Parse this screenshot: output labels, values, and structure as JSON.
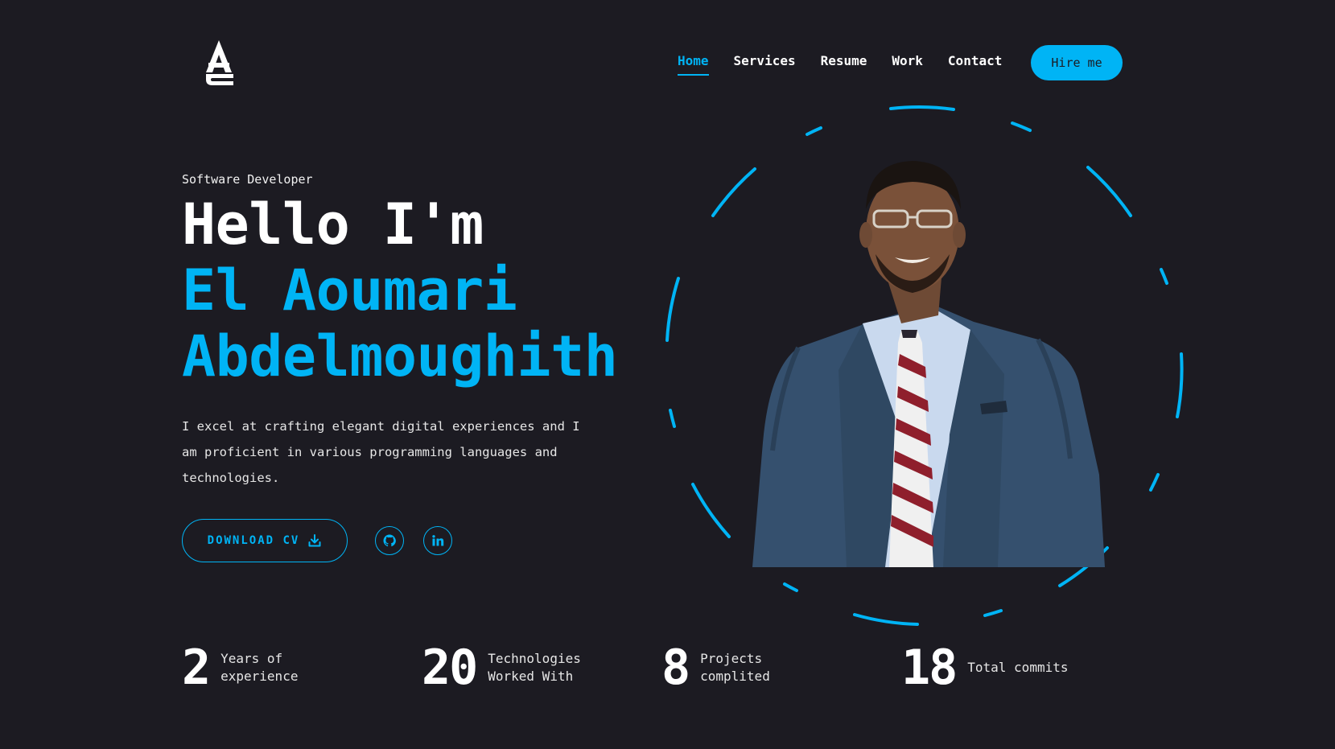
{
  "brand": {
    "logo_icon": "ae-monogram-logo"
  },
  "nav": {
    "items": [
      {
        "label": "Home",
        "active": true
      },
      {
        "label": "Services",
        "active": false
      },
      {
        "label": "Resume",
        "active": false
      },
      {
        "label": "Work",
        "active": false
      },
      {
        "label": "Contact",
        "active": false
      }
    ],
    "hire_label": "Hire me"
  },
  "hero": {
    "role": "Software Developer",
    "greeting": "Hello I'm",
    "first_name": "El Aoumari",
    "last_name": "Abdelmoughith",
    "description": "I excel at crafting elegant digital experiences and I am proficient in various programming languages and technologies.",
    "download_label": "DOWNLOAD CV",
    "socials": [
      {
        "name": "github",
        "icon": "github-icon"
      },
      {
        "name": "linkedin",
        "icon": "linkedin-icon"
      }
    ]
  },
  "stats": [
    {
      "value": "2",
      "label": "Years of experience"
    },
    {
      "value": "20",
      "label": "Technologies Worked With"
    },
    {
      "value": "8",
      "label": "Projects complited"
    },
    {
      "value": "18",
      "label": "Total commits"
    }
  ],
  "colors": {
    "background": "#1c1b22",
    "accent": "#00b4f5",
    "text": "#ffffff"
  }
}
